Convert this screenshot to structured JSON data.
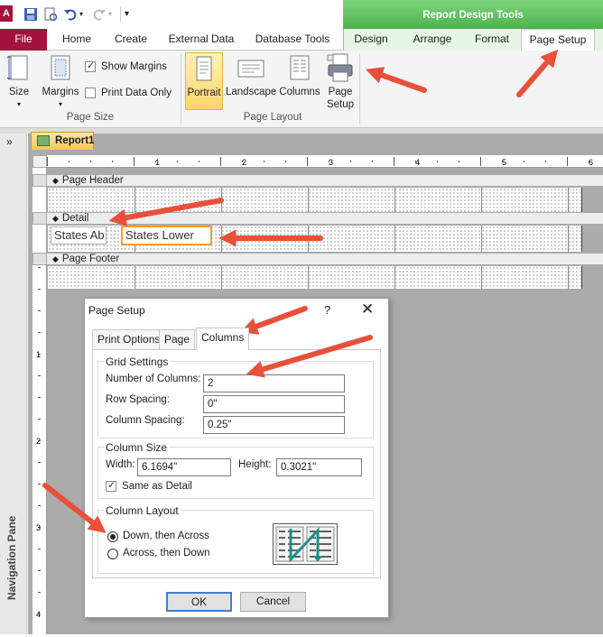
{
  "colors": {
    "accent_file": "#a4133c",
    "context_green": "#5dbd5d",
    "arrow_red": "#e8503a",
    "focus_orange": "#f0a030"
  },
  "context_header": "Report Design Tools",
  "tabs": {
    "file": "File",
    "home": "Home",
    "create": "Create",
    "external_data": "External Data",
    "database_tools": "Database Tools",
    "design": "Design",
    "arrange": "Arrange",
    "format": "Format",
    "page_setup": "Page Setup"
  },
  "ribbon": {
    "page_size": {
      "size": "Size",
      "margins": "Margins",
      "show_margins": "Show Margins",
      "print_data_only": "Print Data Only",
      "group_label": "Page Size",
      "show_margins_checked": true,
      "print_data_only_checked": false
    },
    "page_layout": {
      "portrait": "Portrait",
      "landscape": "Landscape",
      "columns": "Columns",
      "page_setup_l1": "Page",
      "page_setup_l2": "Setup",
      "group_label": "Page Layout"
    }
  },
  "nav_pane": {
    "toggle": "»",
    "title": "Navigation Pane"
  },
  "document": {
    "tab": "Report1"
  },
  "ruler": {
    "top_marks": [
      "1",
      "2",
      "3",
      "4",
      "5",
      "6"
    ],
    "left_marks": [
      "1",
      "2",
      "3",
      "4"
    ]
  },
  "sections": {
    "page_header": "Page Header",
    "detail": "Detail",
    "page_footer": "Page Footer"
  },
  "controls": {
    "label_text": "States Ab",
    "textbox_text": "States Lower"
  },
  "dialog": {
    "title": "Page Setup",
    "help": "?",
    "close": "✕",
    "tabs": [
      "Print Options",
      "Page",
      "Columns"
    ],
    "grid_settings": {
      "title": "Grid Settings",
      "number_of_columns_label": "Number of Columns:",
      "number_of_columns": "2",
      "row_spacing_label": "Row Spacing:",
      "row_spacing": "0\"",
      "column_spacing_label": "Column Spacing:",
      "column_spacing": "0.25\""
    },
    "column_size": {
      "title": "Column Size",
      "width_label": "Width:",
      "width": "6.1694\"",
      "height_label": "Height:",
      "height": "0.3021\"",
      "same_as_detail": "Same as Detail",
      "same_as_detail_checked": true
    },
    "column_layout": {
      "title": "Column Layout",
      "down_then_across": "Down, then Across",
      "across_then_down": "Across, then Down",
      "selected": "down_then_across"
    },
    "ok": "OK",
    "cancel": "Cancel"
  }
}
